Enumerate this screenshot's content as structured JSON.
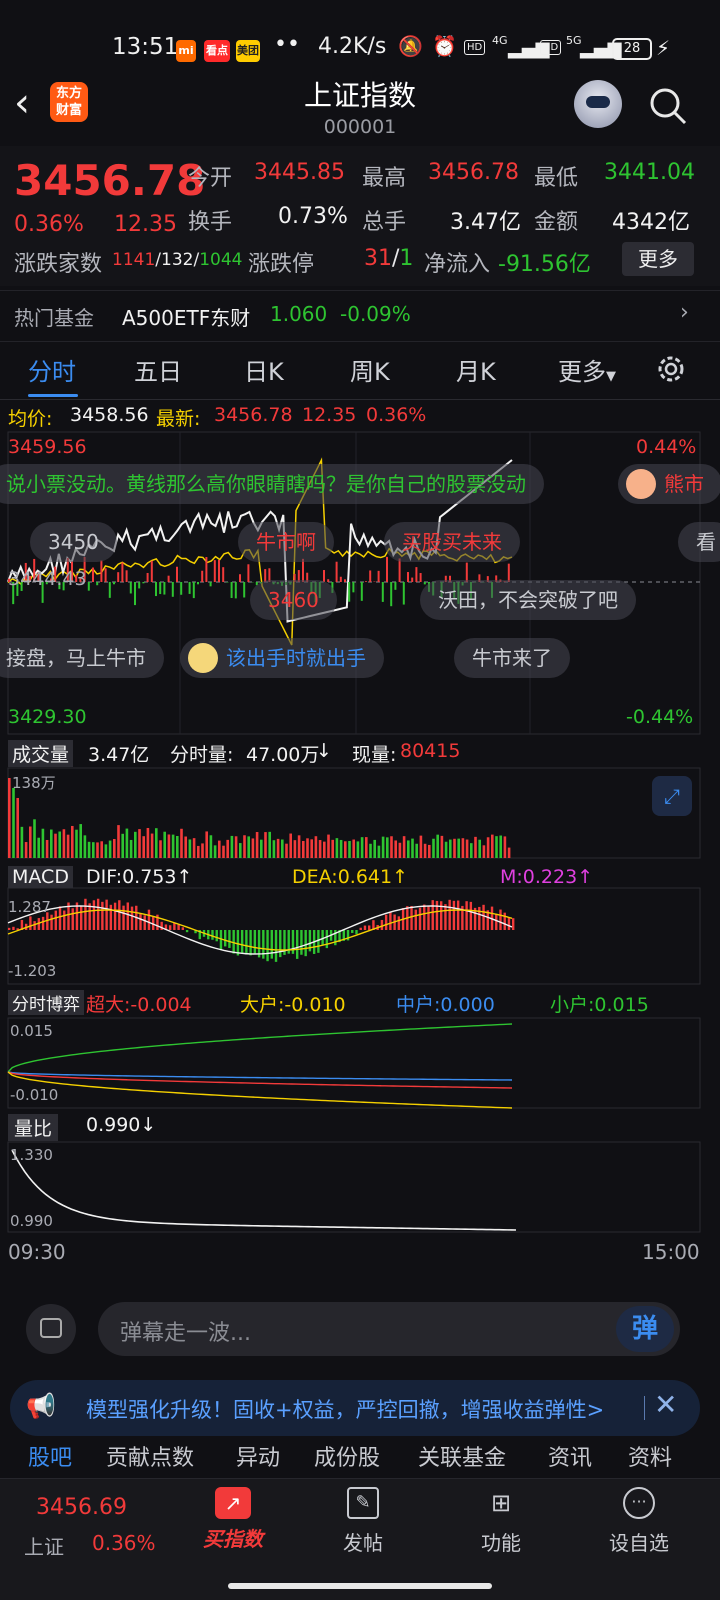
{
  "status_bar": {
    "time": "13:51",
    "net_speed": "4.2K/s",
    "sig1": "4G",
    "sig2": "5G",
    "battery": "28",
    "hd": "HD",
    "apps": [
      "mi",
      "看点",
      "美团"
    ]
  },
  "header": {
    "title": "上证指数",
    "code": "000001",
    "logo_line1": "东方",
    "logo_line2": "财富"
  },
  "quote": {
    "price": "3456.78",
    "change_pct": "0.36%",
    "change": "12.35",
    "open_label": "今开",
    "open": "3445.85",
    "high_label": "最高",
    "high": "3456.78",
    "low_label": "最低",
    "low": "3441.04",
    "turnover_label": "换手",
    "turnover": "0.73%",
    "volume_label": "总手",
    "volume": "3.47亿",
    "amount_label": "金额",
    "amount": "4342亿",
    "breadth_label": "涨跌家数",
    "up": "1141",
    "flat": "132",
    "down": "1044",
    "limit_label": "涨跌停",
    "limit_up": "31",
    "limit_down": "1",
    "inflow_label": "净流入",
    "inflow": "-91.56亿",
    "more_label": "更多"
  },
  "hot_fund": {
    "label": "热门基金",
    "name": "A500ETF东财",
    "price": "1.060",
    "change": "-0.09%"
  },
  "tabs": [
    "分时",
    "五日",
    "日K",
    "周K",
    "月K",
    "更多"
  ],
  "chart": {
    "avg_label": "均价:",
    "avg_value": "3458.56",
    "latest_label": "最新:",
    "latest_value": "3456.78",
    "latest_change": "12.35",
    "latest_pct": "0.36%",
    "y_top": "3459.56",
    "y_mid": "3444.43",
    "y_bottom": "3429.30",
    "pct_top": "0.44%",
    "pct_bottom": "-0.44%",
    "time_start": "09:30",
    "time_end": "15:00",
    "volume_label": "成交量",
    "volume_total": "3.47亿",
    "volume_min_label": "分时量:",
    "volume_min": "47.00万",
    "current_label": "现量:",
    "current": "80415",
    "volume_scale": "138万",
    "macd_label": "MACD",
    "dif": "DIF:0.753",
    "dea": "DEA:0.641",
    "m": "M:0.223",
    "macd_top": "1.287",
    "macd_bottom": "-1.203",
    "flow_label": "分时博弈",
    "super": "超大:-0.004",
    "big": "大户:-0.010",
    "mid": "中户:0.000",
    "small": "小户:0.015",
    "flow_top": "0.015",
    "flow_bottom": "-0.010",
    "ratio_label": "量比",
    "ratio_value": "0.990",
    "ratio_top": "1.330",
    "ratio_bottom": "0.990"
  },
  "danmu": [
    "说小票没动。黄线那么高你眼睛瞎吗？是你自己的股票没动",
    "熊市",
    "3450",
    "牛市啊",
    "买股买未来",
    "看",
    "3460",
    "沃田，不会突破了吧",
    "接盘，马上牛市",
    "该出手时就出手",
    "牛市来了"
  ],
  "input": {
    "placeholder": "弹幕走一波...",
    "send_label": "弹"
  },
  "banner": {
    "text": "模型强化升级！固收+权益，严控回撤，增强收益弹性>"
  },
  "bottom_tabs": [
    "股吧",
    "贡献点数",
    "异动",
    "成份股",
    "关联基金",
    "资讯",
    "资料"
  ],
  "nav": {
    "index_price": "3456.69",
    "index_name": "上证",
    "index_pct": "0.36%",
    "items": [
      "买指数",
      "发帖",
      "功能",
      "设自选"
    ]
  },
  "colors": {
    "up": "#f23a3a",
    "down": "#2ec431",
    "accent": "#3b8cf0",
    "avg_line": "#f5d000"
  }
}
